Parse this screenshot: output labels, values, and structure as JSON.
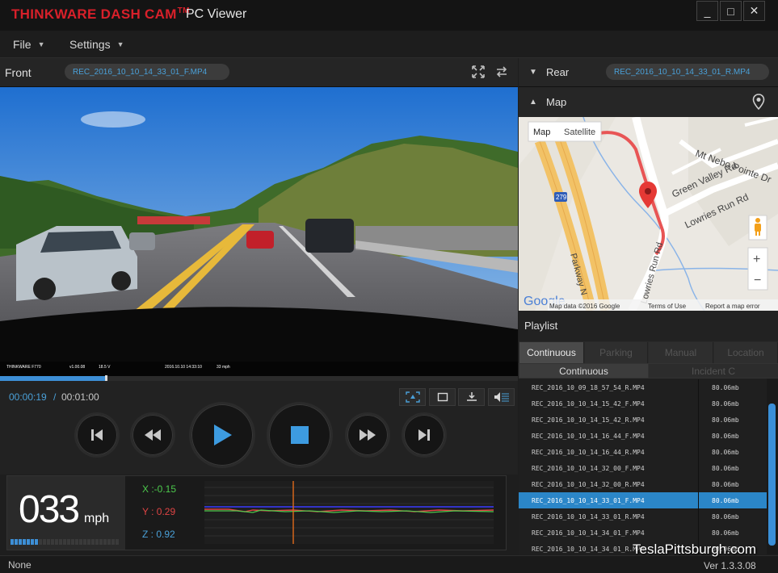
{
  "app": {
    "brand": "THINKWARE DASH CAM",
    "trademark": "TM",
    "name": "PC Viewer"
  },
  "window_controls": [
    "_",
    "□",
    "✕"
  ],
  "menu": [
    {
      "label": "File"
    },
    {
      "label": "Settings"
    }
  ],
  "front": {
    "label": "Front",
    "file": "REC_2016_10_10_14_33_01_F.MP4",
    "overlay": [
      "THINKWARE F770",
      "v1.00.08",
      "18.5 V",
      "2016.10.10 14:33:10",
      "33 mph"
    ]
  },
  "rear": {
    "label": "Rear",
    "file": "REC_2016_10_10_14_33_01_R.MP4"
  },
  "map": {
    "label": "Map",
    "type_map": "Map",
    "type_satellite": "Satellite",
    "roads": [
      "Mt Nebo Pointe Dr",
      "Green Valley Rd",
      "Lowries Run Rd",
      "Lowries Run Rd",
      "Parkway N"
    ],
    "shield": "279",
    "google": "Google",
    "attribution": "Map data ©2016 Google",
    "terms": "Terms of Use",
    "report": "Report a map error",
    "zoom_in": "+",
    "zoom_out": "−"
  },
  "playback": {
    "current": "00:00:19",
    "separator": "/",
    "total": "00:01:00",
    "progress": 0.317
  },
  "telemetry": {
    "speed": "033",
    "unit": "mph",
    "speed_level": 0.25,
    "x": "X :-0.15",
    "y": "Y : 0.29",
    "z": "Z : 0.92"
  },
  "playlist": {
    "title": "Playlist",
    "tabs": [
      "Continuous",
      "Parking",
      "Manual",
      "Location"
    ],
    "subtabs": [
      "Continuous",
      "Incident C"
    ],
    "rows": [
      {
        "name": "REC_2016_10_09_18_57_54_R.MP4",
        "size": "80.06mb"
      },
      {
        "name": "REC_2016_10_10_14_15_42_F.MP4",
        "size": "80.06mb"
      },
      {
        "name": "REC_2016_10_10_14_15_42_R.MP4",
        "size": "80.06mb"
      },
      {
        "name": "REC_2016_10_10_14_16_44_F.MP4",
        "size": "80.06mb"
      },
      {
        "name": "REC_2016_10_10_14_16_44_R.MP4",
        "size": "80.06mb"
      },
      {
        "name": "REC_2016_10_10_14_32_00_F.MP4",
        "size": "80.06mb"
      },
      {
        "name": "REC_2016_10_10_14_32_00_R.MP4",
        "size": "80.06mb"
      },
      {
        "name": "REC_2016_10_10_14_33_01_F.MP4",
        "size": "80.06mb",
        "selected": true
      },
      {
        "name": "REC_2016_10_10_14_33_01_R.MP4",
        "size": "80.06mb"
      },
      {
        "name": "REC_2016_10_10_14_34_01_F.MP4",
        "size": "80.06mb"
      },
      {
        "name": "REC_2016_10_10_14_34_01_R.MP4",
        "size": "80.06mb"
      }
    ]
  },
  "status": "None",
  "version": "Ver 1.3.3.08",
  "watermark": "TeslaPittsburgh.com",
  "colors": {
    "accent": "#3d8fd6",
    "brand_red": "#d8202a",
    "gx": "#4cc94c",
    "gy": "#e04444",
    "gz": "#4aa0d8",
    "route": "#e85555"
  },
  "icons": {
    "fullscreen": "expand-icon",
    "swap": "swap-icon",
    "location": "location-pin-icon",
    "pegman": "pegman-icon"
  }
}
